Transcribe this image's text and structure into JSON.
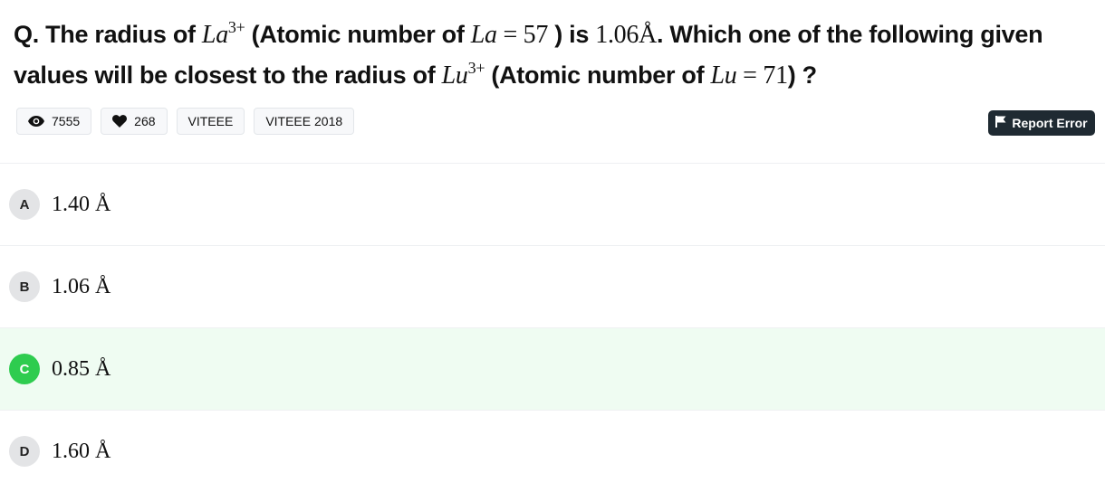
{
  "question": {
    "prefix": "Q. The radius of ",
    "ion1_base": "La",
    "ion1_charge": "3+",
    "part2": " (Atomic number of ",
    "el1_symbol": "La",
    "eq1": " = 57",
    "part3": " ) is ",
    "radius_value": "1.06Å",
    "part4": ". Which one of the following given values will be closest to the radius of ",
    "ion2_base": "Lu",
    "ion2_charge": "3+",
    "part5": " (Atomic number of ",
    "el2_symbol": "Lu",
    "eq2": " = 71",
    "part6": ") ?"
  },
  "meta": {
    "views": "7555",
    "likes": "268",
    "tags": [
      "VITEEE",
      "VITEEE 2018"
    ]
  },
  "report_button": {
    "label": "Report Error"
  },
  "options": [
    {
      "letter": "A",
      "text": "1.40 Å",
      "correct": false
    },
    {
      "letter": "B",
      "text": "1.06 Å",
      "correct": false
    },
    {
      "letter": "C",
      "text": "0.85 Å",
      "correct": true
    },
    {
      "letter": "D",
      "text": "1.60 Å",
      "correct": false
    }
  ],
  "colors": {
    "correct_bg": "#effcf2",
    "correct_badge": "#2ecc4f",
    "report_bg": "#1f2a32"
  },
  "icons": {
    "views": "eye-icon",
    "likes": "heart-icon",
    "report": "flag-icon"
  }
}
